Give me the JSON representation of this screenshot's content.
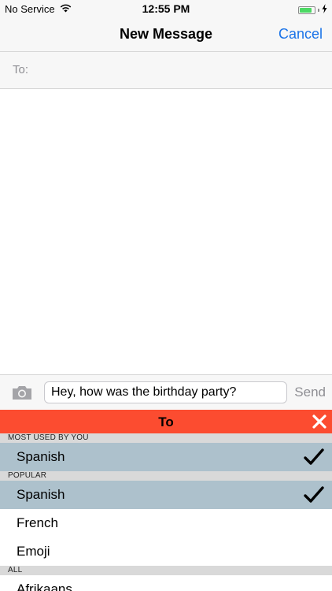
{
  "status": {
    "carrier": "No Service",
    "time": "12:55 PM",
    "battery_level": 0.85,
    "battery_color": "#4cd964"
  },
  "nav": {
    "title": "New Message",
    "cancel_label": "Cancel"
  },
  "recipient": {
    "label": "To:"
  },
  "compose": {
    "camera_icon": "camera-icon",
    "message_text": "Hey, how was the birthday party?",
    "send_label": "Send"
  },
  "translate_panel": {
    "title": "To",
    "accent_color": "#fc4c30",
    "close_icon": "close-icon",
    "sections": [
      {
        "header": "MOST USED BY YOU",
        "items": [
          {
            "label": "Spanish",
            "selected": true
          }
        ]
      },
      {
        "header": "POPULAR",
        "items": [
          {
            "label": "Spanish",
            "selected": true
          },
          {
            "label": "French",
            "selected": false
          },
          {
            "label": "Emoji",
            "selected": false
          }
        ]
      },
      {
        "header": "ALL",
        "items": [
          {
            "label": "Afrikaans",
            "selected": false
          }
        ]
      }
    ]
  }
}
